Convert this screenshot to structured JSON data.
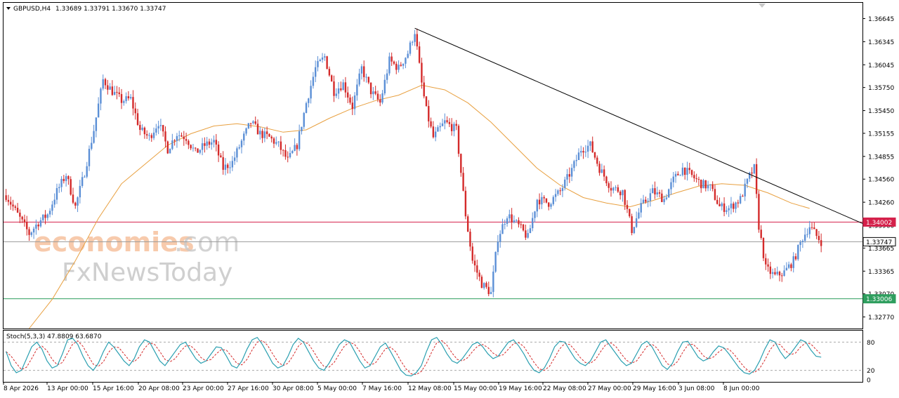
{
  "header": {
    "symbol": "GBPUSD,H4",
    "ohlc": "1.33689 1.33791 1.33670 1.33747",
    "stoch_label": "Stoch(5,3,3) 47.8809 63.6870"
  },
  "watermark": {
    "line1a": "economies",
    "line1b": ".com",
    "line2": "FxNewsToday"
  },
  "colors": {
    "bull": "#5b8fd6",
    "bear": "#d42a2a",
    "ma": "#e8a040",
    "trend": "#000000",
    "resistance": "#d4204a",
    "support": "#2e9e5e",
    "current": "#999999",
    "stoch_main": "#2a9fb0",
    "stoch_signal": "#d42a2a"
  },
  "chart_data": {
    "type": "candlestick",
    "title": "GBPUSD,H4",
    "ylim": [
      1.3262,
      1.3685
    ],
    "y_ticks": [
      "1.36645",
      "1.36345",
      "1.36045",
      "1.35750",
      "1.35450",
      "1.35155",
      "1.34855",
      "1.34560",
      "1.34260",
      "1.33960",
      "1.33665",
      "1.33365",
      "1.33070",
      "1.32770"
    ],
    "x_ticks": [
      "8 Apr 2026",
      "13 Apr 00:00",
      "15 Apr 16:00",
      "20 Apr 08:00",
      "23 Apr 00:00",
      "27 Apr 16:00",
      "30 Apr 08:00",
      "5 May 00:00",
      "7 May 16:00",
      "12 May 08:00",
      "15 May 00:00",
      "19 May 16:00",
      "22 May 08:00",
      "27 May 00:00",
      "29 May 16:00",
      "3 Jun 08:00",
      "8 Jun 00:00"
    ],
    "price_levels": [
      {
        "label": "1.34002",
        "value": 1.34002,
        "kind": "resistance"
      },
      {
        "label": "1.33747",
        "value": 1.33747,
        "kind": "current"
      },
      {
        "label": "1.33006",
        "value": 1.33006,
        "kind": "support"
      }
    ],
    "trendline": {
      "from_bar": 177,
      "from_price": 1.3652,
      "to_bar": 372,
      "to_price": 1.3397
    },
    "close_path": [
      [
        0,
        1.3435
      ],
      [
        6,
        1.3405
      ],
      [
        10,
        1.3385
      ],
      [
        14,
        1.34
      ],
      [
        18,
        1.341
      ],
      [
        22,
        1.344
      ],
      [
        26,
        1.3462
      ],
      [
        30,
        1.342
      ],
      [
        34,
        1.3465
      ],
      [
        38,
        1.352
      ],
      [
        42,
        1.3585
      ],
      [
        46,
        1.357
      ],
      [
        50,
        1.3558
      ],
      [
        54,
        1.356
      ],
      [
        58,
        1.352
      ],
      [
        62,
        1.351
      ],
      [
        66,
        1.353
      ],
      [
        70,
        1.3495
      ],
      [
        74,
        1.3515
      ],
      [
        78,
        1.351
      ],
      [
        82,
        1.349
      ],
      [
        86,
        1.35
      ],
      [
        90,
        1.3505
      ],
      [
        94,
        1.347
      ],
      [
        98,
        1.3478
      ],
      [
        102,
        1.3505
      ],
      [
        106,
        1.353
      ],
      [
        110,
        1.3515
      ],
      [
        114,
        1.351
      ],
      [
        118,
        1.35
      ],
      [
        122,
        1.348
      ],
      [
        126,
        1.35
      ],
      [
        130,
        1.3555
      ],
      [
        134,
        1.36
      ],
      [
        138,
        1.3615
      ],
      [
        142,
        1.357
      ],
      [
        146,
        1.358
      ],
      [
        150,
        1.355
      ],
      [
        154,
        1.36
      ],
      [
        158,
        1.357
      ],
      [
        162,
        1.3555
      ],
      [
        166,
        1.361
      ],
      [
        170,
        1.36
      ],
      [
        174,
        1.362
      ],
      [
        177,
        1.3648
      ],
      [
        180,
        1.358
      ],
      [
        182,
        1.3545
      ],
      [
        185,
        1.351
      ],
      [
        190,
        1.353
      ],
      [
        195,
        1.352
      ],
      [
        199,
        1.341
      ],
      [
        202,
        1.335
      ],
      [
        206,
        1.332
      ],
      [
        210,
        1.3308
      ],
      [
        213,
        1.338
      ],
      [
        217,
        1.341
      ],
      [
        222,
        1.3395
      ],
      [
        226,
        1.338
      ],
      [
        230,
        1.343
      ],
      [
        235,
        1.3425
      ],
      [
        240,
        1.344
      ],
      [
        245,
        1.3468
      ],
      [
        249,
        1.3495
      ],
      [
        253,
        1.35
      ],
      [
        257,
        1.347
      ],
      [
        262,
        1.3445
      ],
      [
        267,
        1.344
      ],
      [
        271,
        1.339
      ],
      [
        275,
        1.342
      ],
      [
        280,
        1.344
      ],
      [
        285,
        1.343
      ],
      [
        289,
        1.3455
      ],
      [
        293,
        1.347
      ],
      [
        297,
        1.346
      ],
      [
        301,
        1.345
      ],
      [
        305,
        1.3445
      ],
      [
        309,
        1.342
      ],
      [
        313,
        1.3418
      ],
      [
        318,
        1.343
      ],
      [
        322,
        1.346
      ],
      [
        324,
        1.347
      ],
      [
        326,
        1.3395
      ],
      [
        329,
        1.334
      ],
      [
        333,
        1.333
      ],
      [
        337,
        1.3335
      ],
      [
        341,
        1.335
      ],
      [
        345,
        1.338
      ],
      [
        348,
        1.3395
      ],
      [
        351,
        1.3382
      ],
      [
        353,
        1.3375
      ]
    ],
    "moving_average": {
      "name": "",
      "points": [
        [
          10,
          1.3262
        ],
        [
          20,
          1.33
        ],
        [
          30,
          1.335
        ],
        [
          40,
          1.3405
        ],
        [
          50,
          1.345
        ],
        [
          60,
          1.3475
        ],
        [
          70,
          1.35
        ],
        [
          80,
          1.3515
        ],
        [
          90,
          1.3525
        ],
        [
          100,
          1.3528
        ],
        [
          110,
          1.3524
        ],
        [
          120,
          1.3517
        ],
        [
          130,
          1.352
        ],
        [
          140,
          1.3535
        ],
        [
          150,
          1.3548
        ],
        [
          160,
          1.3558
        ],
        [
          170,
          1.3565
        ],
        [
          180,
          1.3578
        ],
        [
          190,
          1.3572
        ],
        [
          200,
          1.3555
        ],
        [
          210,
          1.353
        ],
        [
          220,
          1.35
        ],
        [
          230,
          1.347
        ],
        [
          240,
          1.3448
        ],
        [
          250,
          1.3432
        ],
        [
          260,
          1.3425
        ],
        [
          270,
          1.342
        ],
        [
          280,
          1.3428
        ],
        [
          290,
          1.3438
        ],
        [
          300,
          1.3447
        ],
        [
          310,
          1.345
        ],
        [
          320,
          1.3448
        ],
        [
          330,
          1.3438
        ],
        [
          340,
          1.3425
        ],
        [
          348,
          1.3418
        ]
      ]
    },
    "indicator": {
      "name": "Stoch(5,3,3)",
      "main": 47.8809,
      "signal": 63.687,
      "ylim": [
        0,
        100
      ],
      "levels": [
        20,
        80
      ],
      "level_labels": [
        "80",
        "20",
        "0"
      ],
      "series_main": [
        60,
        30,
        15,
        20,
        45,
        70,
        80,
        65,
        40,
        25,
        30,
        55,
        85,
        88,
        75,
        50,
        30,
        20,
        35,
        60,
        80,
        70,
        55,
        40,
        30,
        45,
        70,
        85,
        80,
        60,
        40,
        30,
        45,
        60,
        75,
        80,
        62,
        45,
        35,
        40,
        55,
        70,
        68,
        50,
        30,
        25,
        40,
        65,
        85,
        90,
        75,
        55,
        35,
        25,
        30,
        50,
        75,
        88,
        80,
        60,
        40,
        25,
        20,
        35,
        55,
        75,
        85,
        80,
        60,
        40,
        25,
        30,
        50,
        70,
        78,
        60,
        40,
        20,
        10,
        8,
        15,
        30,
        60,
        85,
        90,
        75,
        55,
        40,
        35,
        45,
        60,
        75,
        80,
        70,
        55,
        45,
        50,
        65,
        80,
        85,
        72,
        55,
        35,
        20,
        15,
        25,
        45,
        70,
        82,
        80,
        62,
        45,
        35,
        30,
        40,
        60,
        80,
        85,
        70,
        55,
        40,
        30,
        35,
        55,
        75,
        82,
        70,
        50,
        30,
        22,
        35,
        60,
        80,
        82,
        65,
        48,
        40,
        45,
        60,
        72,
        68,
        55,
        40,
        25,
        15,
        12,
        20,
        40,
        65,
        85,
        80,
        60,
        45,
        55,
        70,
        85,
        80,
        63,
        50,
        48
      ]
    }
  }
}
